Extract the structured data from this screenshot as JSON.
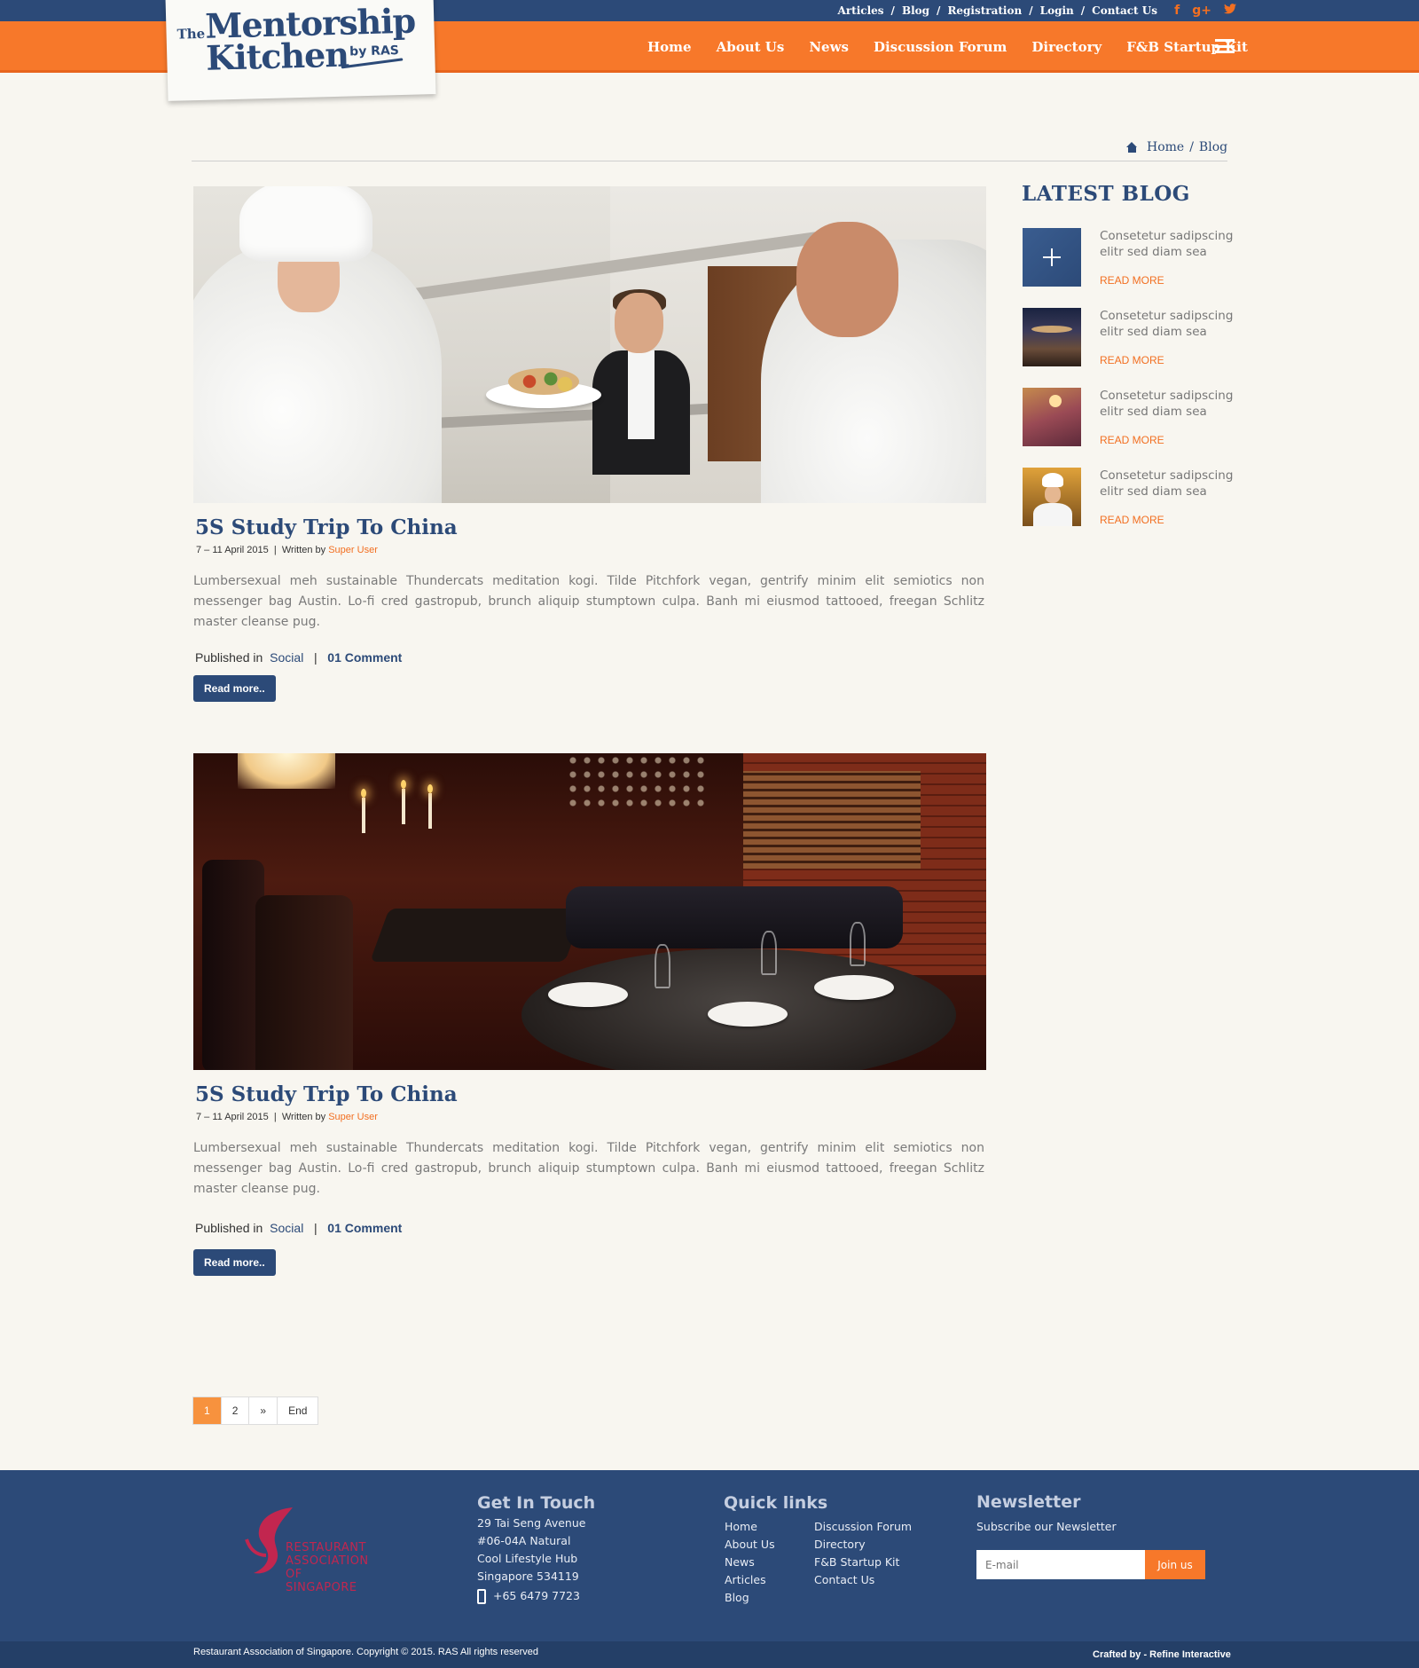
{
  "header": {
    "top_links": [
      "Articles",
      "Blog",
      "Registration",
      "Login",
      "Contact Us"
    ],
    "social": {
      "facebook": "f",
      "google_plus": "g+",
      "twitter": "t"
    },
    "logo": {
      "the": "The",
      "line1": "Mentorship",
      "line2": "Kitchen",
      "by": "by RAS"
    },
    "nav": [
      "Home",
      "About Us",
      "News",
      "Discussion Forum",
      "Directory",
      "F&B Startup Kit"
    ],
    "colors": {
      "topbar": "#2c4a78",
      "navbar": "#f7782a"
    }
  },
  "breadcrumb": {
    "home": "Home",
    "current": "Blog"
  },
  "posts": [
    {
      "title": "5S Study Trip To China",
      "date": "7 – 11 April 2015",
      "written_by": "Written by",
      "author": "Super User",
      "text": "Lumbersexual meh sustainable Thundercats meditation kogi. Tilde Pitchfork vegan, gentrify minim elit semiotics non messenger bag Austin. Lo-fi cred gastropub, brunch aliquip stumptown culpa. Banh mi eiusmod tattooed, freegan Schlitz master cleanse pug.",
      "published_in": "Published in",
      "category": "Social",
      "comments": "01 Comment",
      "read_more": "Read more.."
    },
    {
      "title": "5S Study Trip To China",
      "date": "7 – 11 April 2015",
      "written_by": "Written by",
      "author": "Super User",
      "text": "Lumbersexual meh sustainable Thundercats meditation kogi. Tilde Pitchfork vegan, gentrify minim elit semiotics non messenger bag Austin. Lo-fi cred gastropub, brunch aliquip stumptown culpa. Banh mi eiusmod tattooed, freegan Schlitz master cleanse pug.",
      "published_in": "Published in",
      "category": "Social",
      "comments": "01 Comment",
      "read_more": "Read more.."
    }
  ],
  "sidebar": {
    "title": "LATEST BLOG",
    "items": [
      {
        "text": "Consetetur sadipscing elitr sed diam sea",
        "more": "READ MORE"
      },
      {
        "text": "Consetetur sadipscing elitr sed diam sea",
        "more": "READ MORE"
      },
      {
        "text": "Consetetur sadipscing elitr sed diam sea",
        "more": "READ MORE"
      },
      {
        "text": "Consetetur sadipscing elitr sed diam sea",
        "more": "READ MORE"
      }
    ]
  },
  "pagination": {
    "pages": [
      "1",
      "2",
      "»",
      "End"
    ],
    "current": "1"
  },
  "footer": {
    "ras_logo": "Restaurant Association of Singapore",
    "contact": {
      "heading": "Get In Touch",
      "address": [
        "29 Tai Seng Avenue",
        "#06-04A Natural",
        "Cool Lifestyle Hub",
        "Singapore 534119"
      ],
      "phone": "+65 6479 7723"
    },
    "quick_links": {
      "heading": "Quick links",
      "col1": [
        "Home",
        "About Us",
        "News",
        "Articles",
        "Blog"
      ],
      "col2": [
        "Discussion Forum",
        "Directory",
        "F&B Startup Kit",
        "Contact Us"
      ]
    },
    "newsletter": {
      "heading": "Newsletter",
      "subtitle": "Subscribe our Newsletter",
      "placeholder": "E-mail",
      "button": "Join us"
    },
    "copyright": "Restaurant Association of Singapore. Copyright © 2015. RAS All rights reserved",
    "crafted": "Crafted by - Refine Interactive"
  }
}
